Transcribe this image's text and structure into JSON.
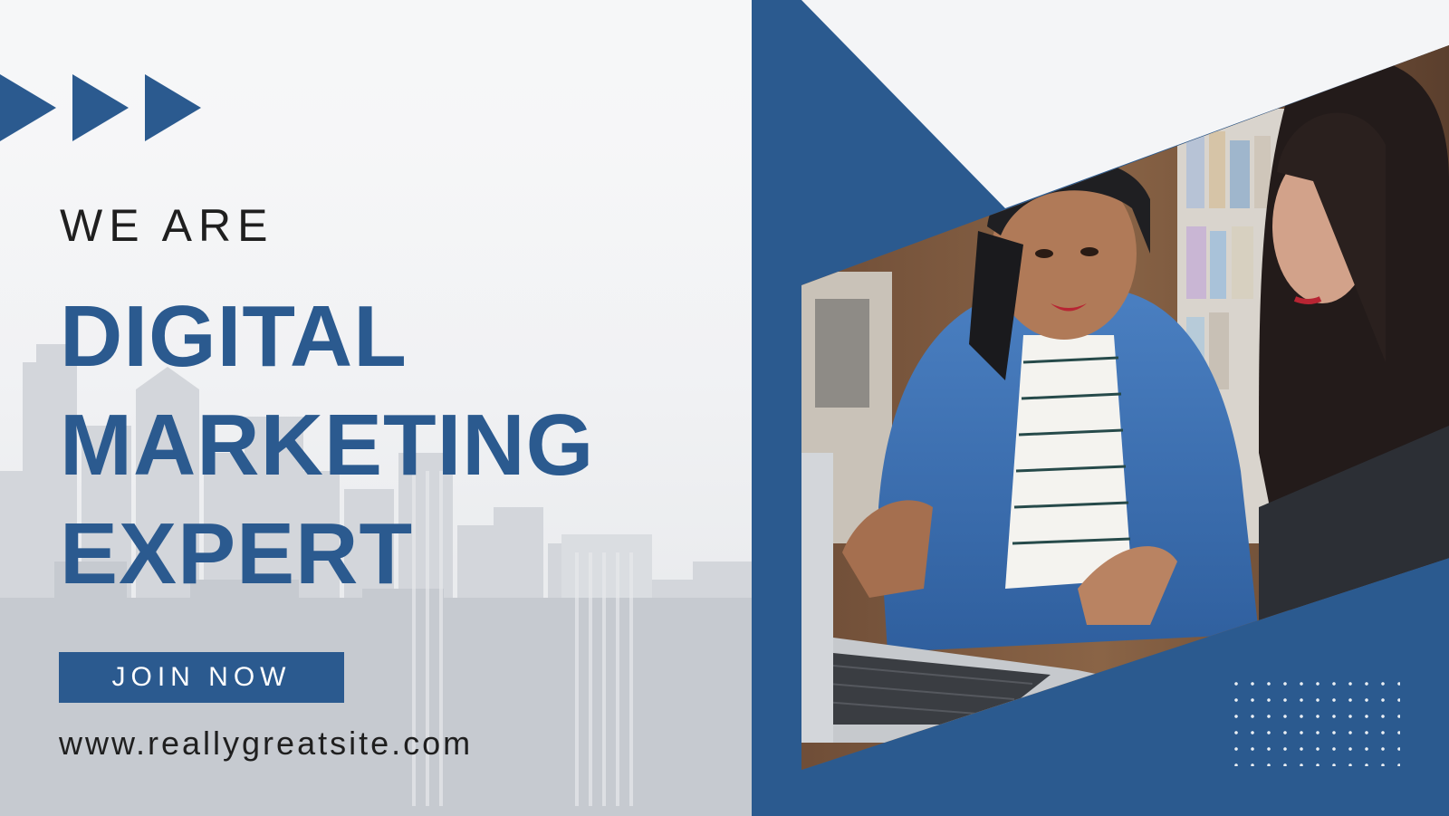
{
  "headline": {
    "intro": "WE ARE",
    "lines": [
      "DIGITAL",
      "MARKETING",
      "EXPERT"
    ]
  },
  "cta": {
    "label": "JOIN NOW"
  },
  "website": "www.reallygreatsite.com",
  "colors": {
    "brand_blue": "#2b5a8f",
    "text_dark": "#1f1f1f",
    "background": "#f3f4f6",
    "white": "#ffffff"
  },
  "icons": {
    "arrows": "triple-play-arrows-icon",
    "dots": "dot-grid-pattern"
  },
  "photo": {
    "subject": "two-women-working-on-laptop-photo"
  }
}
